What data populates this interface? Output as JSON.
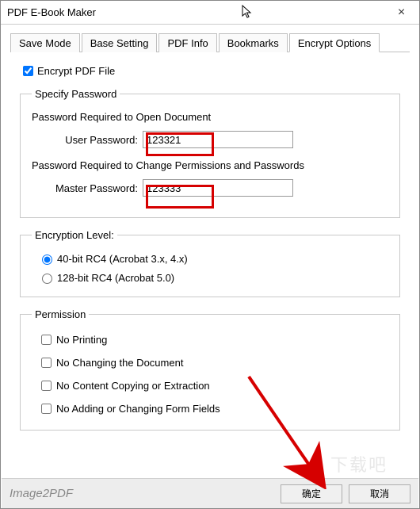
{
  "window": {
    "title": "PDF E-Book Maker",
    "close_icon": "×"
  },
  "tabs": [
    {
      "label": "Save Mode",
      "active": false
    },
    {
      "label": "Base Setting",
      "active": false
    },
    {
      "label": "PDF Info",
      "active": false
    },
    {
      "label": "Bookmarks",
      "active": false
    },
    {
      "label": "Encrypt Options",
      "active": true
    }
  ],
  "encrypt_checkbox": {
    "label": "Encrypt PDF File",
    "checked": true
  },
  "password_group": {
    "legend": "Specify Password",
    "open_doc_label": "Password Required to Open Document",
    "user_pw_label": "User Password:",
    "user_pw_value": "123321",
    "change_perm_label": "Password Required to Change Permissions and Passwords",
    "master_pw_label": "Master Password:",
    "master_pw_value": "123333"
  },
  "encryption_level": {
    "legend": "Encryption Level:",
    "options": [
      {
        "label": "40-bit RC4 (Acrobat 3.x, 4.x)",
        "checked": true
      },
      {
        "label": "128-bit RC4 (Acrobat 5.0)",
        "checked": false
      }
    ]
  },
  "permission": {
    "legend": "Permission",
    "options": [
      {
        "label": "No Printing",
        "checked": false
      },
      {
        "label": "No Changing the Document",
        "checked": false
      },
      {
        "label": "No Content Copying or Extraction",
        "checked": false
      },
      {
        "label": "No Adding or Changing Form Fields",
        "checked": false
      }
    ]
  },
  "footer": {
    "brand": "Image2PDF",
    "ok": "确定",
    "cancel": "取消"
  },
  "watermark": "下载吧"
}
